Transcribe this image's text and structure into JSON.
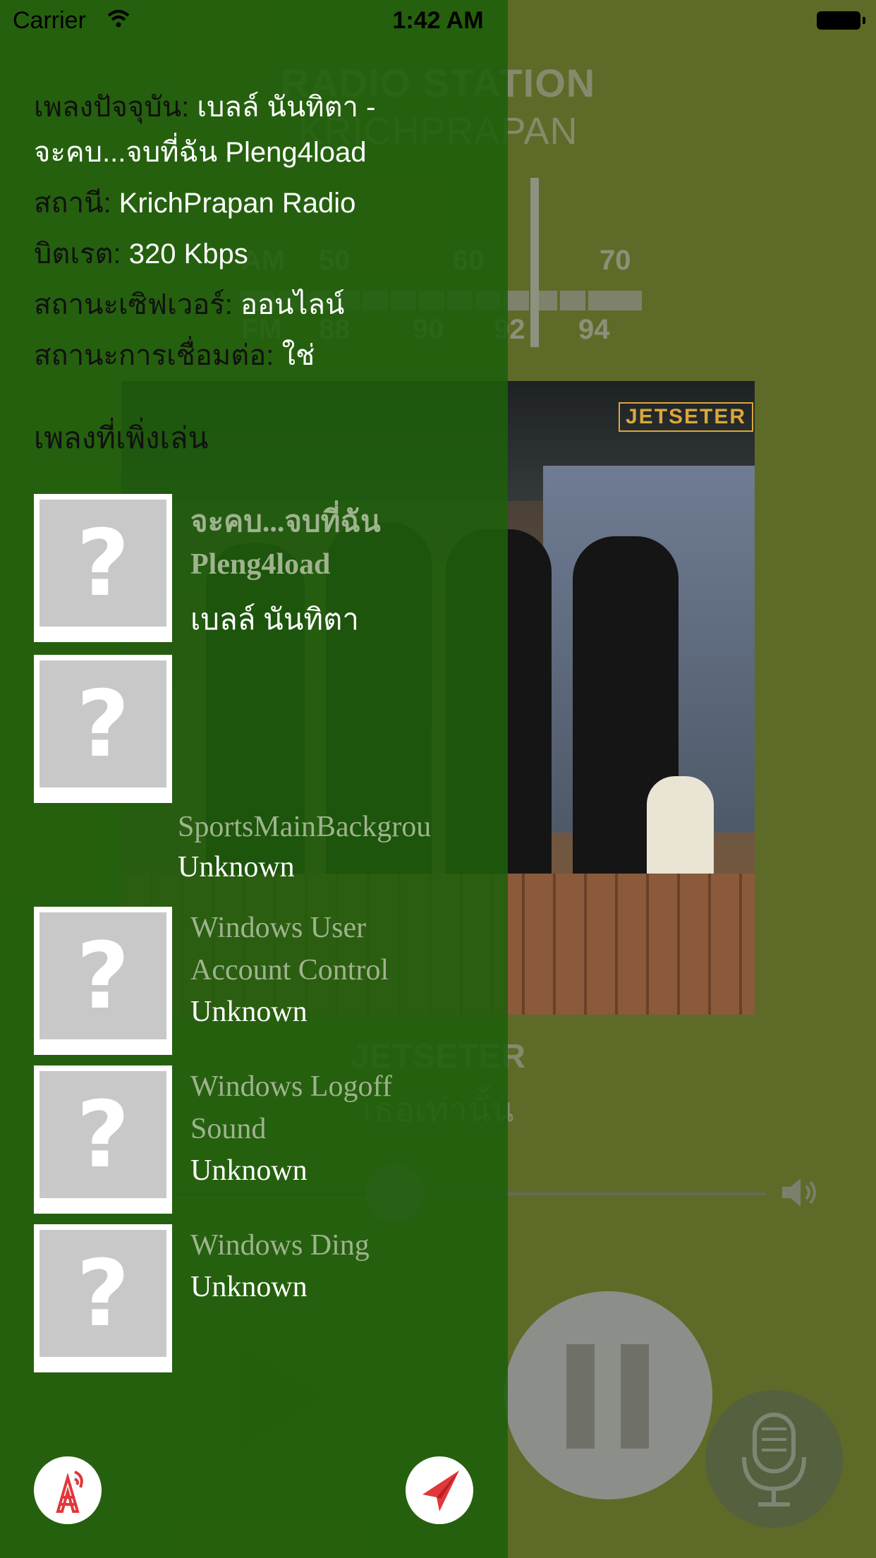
{
  "status_bar": {
    "carrier": "Carrier",
    "time": "1:42 AM"
  },
  "background_player": {
    "title": "RADIO STATION",
    "subtitle": "KRICHPRAPAN",
    "tuner": {
      "am_label": "AM",
      "fm_label": "FM",
      "am_ticks": [
        "50",
        "60",
        "70"
      ],
      "fm_ticks": [
        "88",
        "90",
        "92",
        "94"
      ]
    },
    "album_logo": "JETSETER",
    "artist": "JETSETER",
    "album": "เธอเท่านั้น",
    "volume_level": 0.42,
    "colors": {
      "background": "#5e6b28",
      "panel": "#1e5f0a"
    }
  },
  "info": {
    "now_playing_label": "เพลงปัจจุบัน:",
    "now_playing_value_1": " เบลล์ นันทิตา -",
    "now_playing_value_2": "จะคบ...จบที่ฉัน Pleng4load",
    "station_label": "สถานี:",
    "station_value": " KrichPrapan Radio",
    "bitrate_label": "บิตเรต:",
    "bitrate_value": " 320 Kbps",
    "server_label": "สถานะเซิฟเวอร์:",
    "server_value": " ออนไลน์",
    "connection_label": "สถานะการเชื่อมต่อ:",
    "connection_value": " ใช่"
  },
  "recent": {
    "title": "เพลงที่เพิ่งเล่น",
    "placeholder_glyph": "?",
    "items": [
      {
        "title_1": "จะคบ...จบที่ฉัน",
        "title_2": "Pleng4load",
        "artist": "เบลล์ นันทิตา"
      },
      {
        "title_1": "",
        "title_2": "",
        "artist": ""
      },
      {
        "title_1": "SportsMainBackgrou",
        "title_2": "",
        "artist": "Unknown"
      },
      {
        "title_1": "Windows User",
        "title_2": "Account Control",
        "artist": "Unknown"
      },
      {
        "title_1": "Windows Logoff",
        "title_2": "Sound",
        "artist": "Unknown"
      },
      {
        "title_1": "Windows Ding",
        "title_2": "",
        "artist": "Unknown"
      }
    ]
  },
  "icons": {
    "radio_tower": "radio-tower-icon",
    "paper_plane": "paper-plane-icon",
    "microphone": "microphone-icon",
    "speaker": "speaker-icon"
  }
}
